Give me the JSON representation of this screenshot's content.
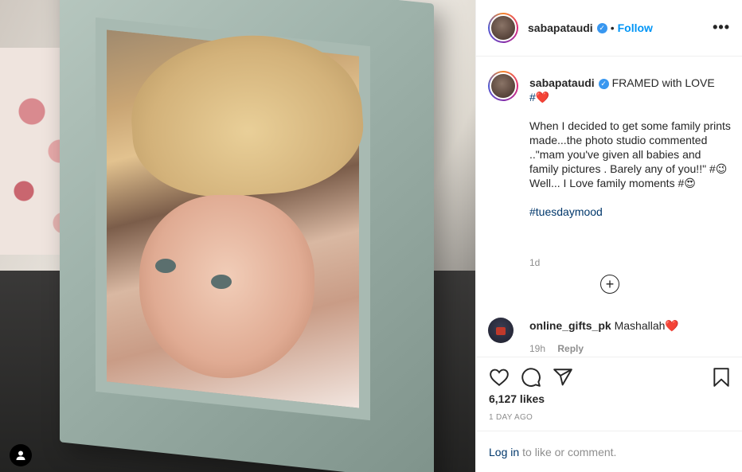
{
  "post": {
    "username": "sabapataudi",
    "follow_label": "Follow",
    "dot": "•",
    "more_label": "•••"
  },
  "caption": {
    "username": "sabapataudi",
    "line1": "FRAMED with LOVE",
    "line2": "#❤️",
    "paragraph": "When I decided to get some family prints made...the photo studio commented ..\"mam you've given all babies and family pictures . Barely any of you!!\" #😉",
    "line3": "Well... I Love family moments #😍",
    "hashtag": "#tuesdaymood",
    "time": "1d"
  },
  "comment": {
    "username": "online_gifts_pk",
    "text": "Mashallah❤️",
    "time": "19h",
    "reply_label": "Reply"
  },
  "engagement": {
    "likes": "6,127 likes",
    "ago": "1 DAY AGO"
  },
  "login": {
    "link": "Log in",
    "rest": "to like or comment."
  },
  "colors": {
    "link_blue": "#0095f6",
    "hashtag_blue": "#00376b",
    "muted": "#8e8e8e",
    "border": "#efefef"
  },
  "icons": [
    "verified-badge-icon",
    "more-options-icon",
    "add-comment-icon",
    "heart-icon",
    "comment-icon",
    "share-icon",
    "bookmark-icon",
    "user-icon"
  ]
}
